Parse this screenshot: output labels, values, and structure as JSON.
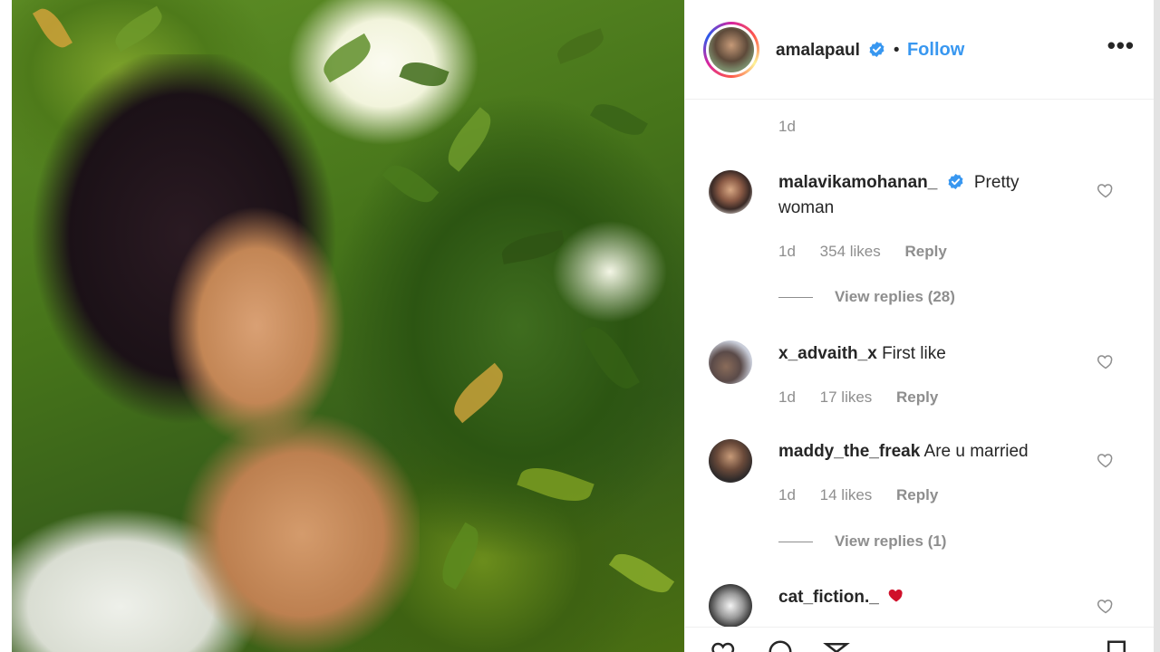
{
  "post": {
    "author": "amalapaul",
    "follow_label": "Follow",
    "separator": "•",
    "posted": "1d"
  },
  "comments": [
    {
      "username": "malavikamohanan_",
      "verified": true,
      "text": "Pretty woman",
      "time": "1d",
      "likes": "354 likes",
      "reply_label": "Reply",
      "view_replies": "View replies (28)"
    },
    {
      "username": "x_advaith_x",
      "verified": false,
      "text": "First like",
      "time": "1d",
      "likes": "17 likes",
      "reply_label": "Reply"
    },
    {
      "username": "maddy_the_freak",
      "verified": false,
      "text": "Are u married",
      "time": "1d",
      "likes": "14 likes",
      "reply_label": "Reply",
      "view_replies": "View replies (1)"
    },
    {
      "username": "cat_fiction._",
      "verified": false,
      "text": "",
      "emoji": "red-heart-emoji"
    }
  ],
  "icons": {
    "more": "more-options-icon",
    "verified": "verified-badge-icon",
    "like": "heart-outline-icon",
    "share": "share-icon",
    "comment": "comment-icon",
    "save": "bookmark-icon"
  },
  "colors": {
    "link_blue": "#3897f0",
    "text": "#262626",
    "muted": "#8e8e8e",
    "verified_blue": "#3897f0",
    "heart_red": "#e0132a"
  }
}
